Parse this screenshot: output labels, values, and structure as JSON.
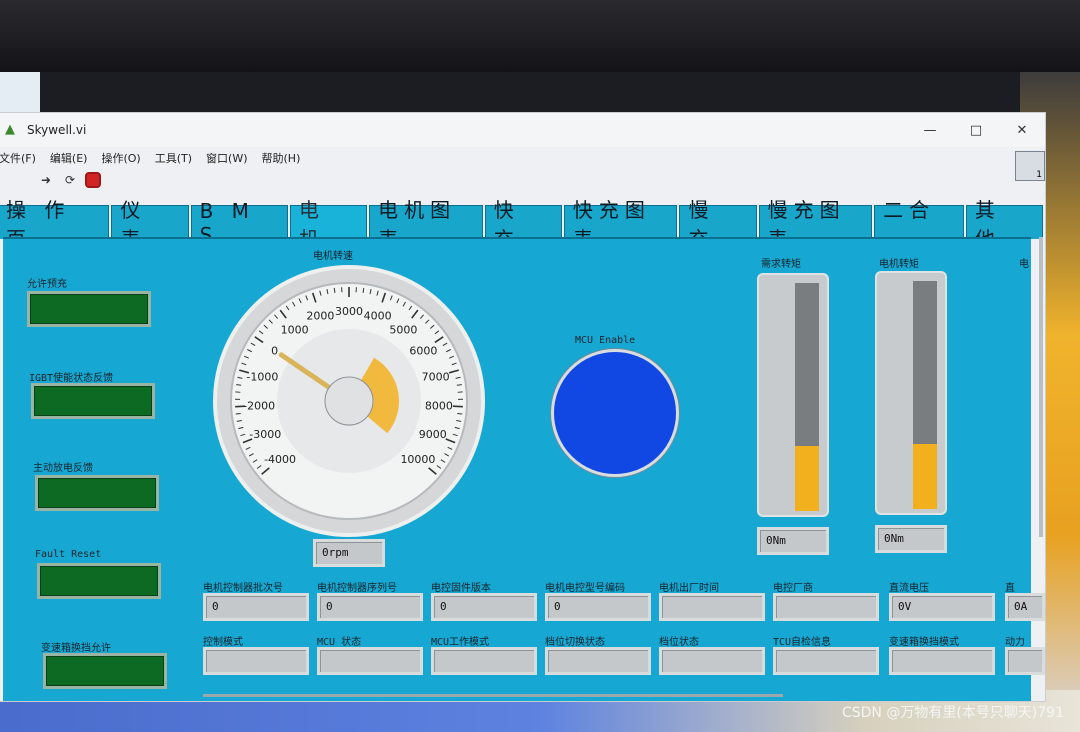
{
  "watermark": "CSDN @万物有里(本号只聊天)791",
  "window": {
    "title": "Skywell.vi",
    "controls": [
      "—",
      "□",
      "✕"
    ],
    "vi_icon_text": "1"
  },
  "menu": [
    "文件(F)",
    "编辑(E)",
    "操作(O)",
    "工具(T)",
    "窗口(W)",
    "帮助(H)"
  ],
  "tabs": [
    "操 作 页",
    "仪 表",
    "B M S",
    "电 机",
    "电机图表",
    "快 充",
    "快充图表",
    "慢 充",
    "慢充图表",
    "二合一",
    "其 他"
  ],
  "active_tab": "电 机",
  "left_leds": [
    {
      "label": "允许预充",
      "value": false
    },
    {
      "label": "IGBT使能状态反馈",
      "value": false
    },
    {
      "label": "主动放电反馈",
      "value": false
    },
    {
      "label": "Fault Reset",
      "value": false
    },
    {
      "label": "变速箱换挡允许",
      "value": false
    }
  ],
  "gauge": {
    "label": "电机转速",
    "min": -4000,
    "max": 10000,
    "ticks": [
      "-4000",
      "-3000",
      "-2000",
      "-1000",
      "0",
      "1000",
      "2000",
      "3000",
      "4000",
      "5000",
      "6000",
      "7000",
      "8000",
      "9000",
      "10000"
    ],
    "value": 0,
    "readout": "0rpm",
    "needle_color": "#d9b45a",
    "accent_color": "#f2b01f"
  },
  "mcu_enable": {
    "label": "MCU Enable",
    "color": "#1148e4",
    "value": true
  },
  "tanks": [
    {
      "label": "需求转矩",
      "scale": [
        "5000",
        "4000",
        "3000",
        "2000",
        "1000",
        "0",
        "-1000",
        "-2000"
      ],
      "value": 0,
      "min": -2000,
      "max": 5000,
      "readout": "0Nm"
    },
    {
      "label": "电机转矩",
      "scale": [
        "5000",
        "4000",
        "3000",
        "2000",
        "1000",
        "0",
        "-1000",
        "-2000"
      ],
      "value": 0,
      "min": -2000,
      "max": 5000,
      "readout": "0Nm"
    }
  ],
  "edge_label": "电",
  "fields_row1": [
    {
      "label": "电机控制器批次号",
      "value": "0"
    },
    {
      "label": "电机控制器序列号",
      "value": "0"
    },
    {
      "label": "电控固件版本",
      "value": "0"
    },
    {
      "label": "电机电控型号编码",
      "value": "0"
    },
    {
      "label": "电机出厂时间",
      "value": ""
    },
    {
      "label": "电控厂商",
      "value": ""
    },
    {
      "label": "直流电压",
      "value": "0V"
    },
    {
      "label": "直",
      "value": "0A"
    }
  ],
  "fields_row2": [
    {
      "label": "控制模式",
      "value": ""
    },
    {
      "label": "MCU 状态",
      "value": ""
    },
    {
      "label": "MCU工作模式",
      "value": ""
    },
    {
      "label": "档位切换状态",
      "value": ""
    },
    {
      "label": "档位状态",
      "value": ""
    },
    {
      "label": "TCU自检信息",
      "value": ""
    },
    {
      "label": "变速箱换挡模式",
      "value": ""
    },
    {
      "label": "动力",
      "value": ""
    }
  ]
}
